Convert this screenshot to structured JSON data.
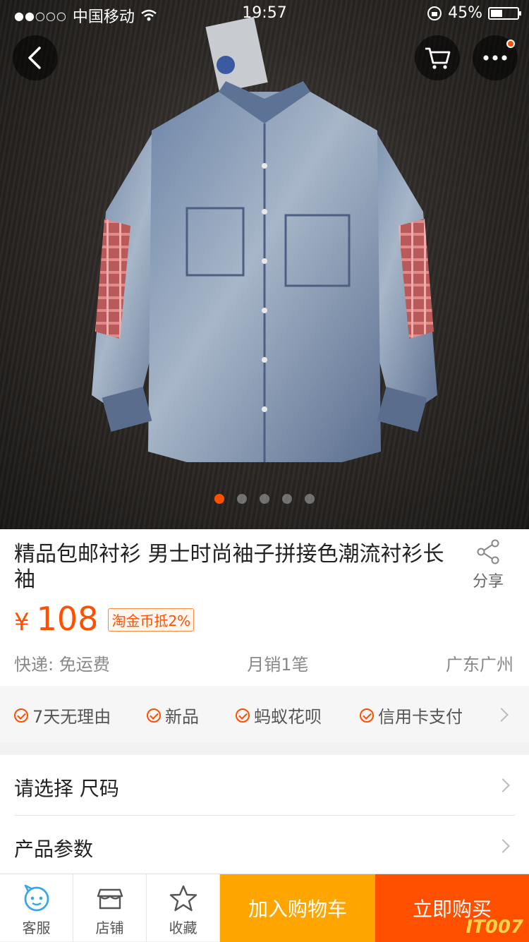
{
  "status_bar": {
    "signal": "●●○○○",
    "carrier": "中国移动",
    "time": "19:57",
    "battery": "45%",
    "battery_level": 0.45
  },
  "gallery": {
    "page_count": 5,
    "active_page": 1,
    "accent_color": "#ff5000"
  },
  "product": {
    "title": "精品包邮衬衫 男士时尚袖子拼接色潮流衬衫长袖",
    "share_label": "分享",
    "currency": "¥",
    "price": "108",
    "coin_tag": "淘金币抵2%",
    "shipping": "快递: 免运费",
    "monthly_sales": "月销1笔",
    "location": "广东广州"
  },
  "services": [
    "7天无理由",
    "新品",
    "蚂蚁花呗",
    "信用卡支付"
  ],
  "options": {
    "select_size": "请选择 尺码",
    "params": "产品参数"
  },
  "bottom_bar": {
    "service_label": "客服",
    "shop_label": "店铺",
    "fav_label": "收藏",
    "add_cart_label": "加入购物车",
    "buy_label": "立即购买",
    "watermark": "IT007"
  }
}
